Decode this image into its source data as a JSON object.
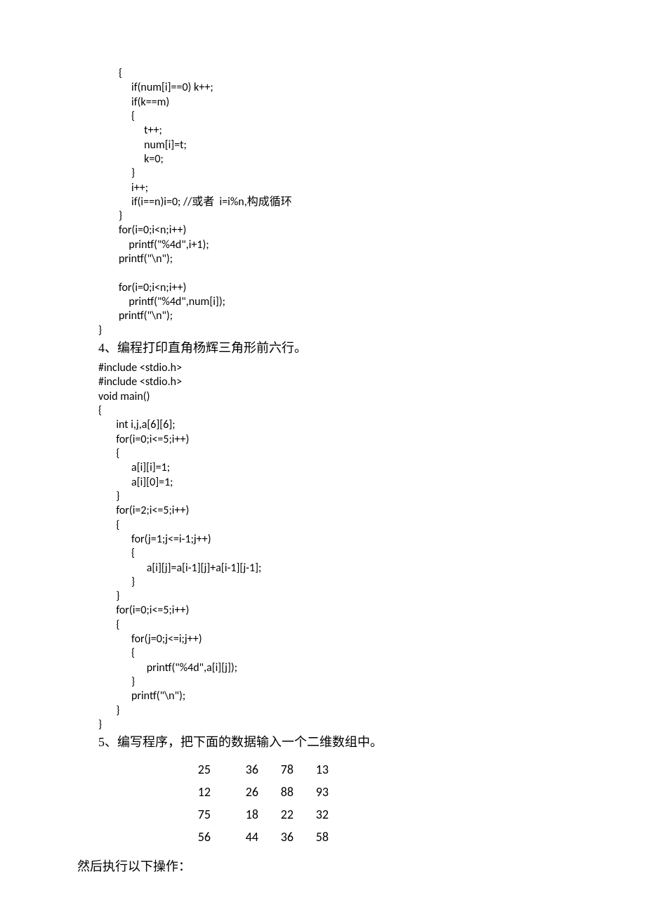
{
  "code_block_1": "        {\n             if(num[i]==0) k++;\n             if(k==m)\n             {\n                  t++;\n                  num[i]=t;\n                  k=0;\n             }\n             i++;\n             if(i==n)i=0; //或者  i=i%n,构成循环\n        }\n        for(i=0;i<n;i++)\n            printf(\"%4d\",i+1);\n        printf(\"\\n\");\n\n        for(i=0;i<n;i++)\n            printf(\"%4d\",num[i]);\n        printf(\"\\n\");\n}",
  "heading_4": " 4、编程打印直角杨辉三角形前六行。",
  "code_block_2": "#include <stdio.h>\n#include <stdio.h>\nvoid main()\n{\n       int i,j,a[6][6];\n       for(i=0;i<=5;i++)\n       {\n             a[i][i]=1;\n             a[i][0]=1;\n       }\n       for(i=2;i<=5;i++)\n       {\n             for(j=1;j<=i-1;j++)\n             {\n                   a[i][j]=a[i-1][j]+a[i-1][j-1];\n             }\n       }\n       for(i=0;i<=5;i++)\n       {\n             for(j=0;j<=i;j++)\n             {\n                   printf(\"%4d\",a[i][j]);\n             }\n             printf(\"\\n\");\n       }\n}",
  "heading_5": " 5、编写程序，把下面的数据输入一个二维数组中。",
  "table": [
    [
      "25",
      "36",
      "78",
      "13"
    ],
    [
      "12",
      "26",
      "88",
      "93"
    ],
    [
      "75",
      "18",
      "22",
      "32"
    ],
    [
      "56",
      "44",
      "36",
      "58"
    ]
  ],
  "footer": "然后执行以下操作："
}
